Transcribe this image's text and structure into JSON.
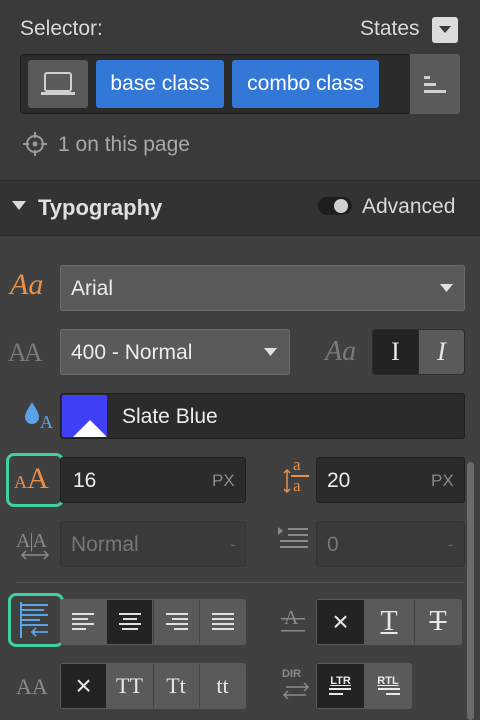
{
  "selector": {
    "label": "Selector:",
    "states_label": "States",
    "chips": [
      "base class",
      "combo class"
    ],
    "count_text": "1 on this page"
  },
  "typography": {
    "title": "Typography",
    "advanced_label": "Advanced",
    "font_family": "Arial",
    "weight": "400 - Normal",
    "color_name": "Slate Blue",
    "color_hex": "#3f3ff5",
    "font_size": "16",
    "font_size_unit": "PX",
    "line_height": "20",
    "line_height_unit": "PX",
    "letter_spacing_placeholder": "Normal",
    "letter_spacing_suffix": "-",
    "text_indent_placeholder": "0",
    "text_indent_suffix": "-",
    "italic_normal": "I",
    "italic_slant": "I",
    "capitalize": {
      "upper": "TT",
      "title": "Tt",
      "lower": "tt"
    },
    "direction": {
      "label": "DIR",
      "ltr": "LTR",
      "rtl": "RTL"
    },
    "decoration": {
      "underline": "T",
      "strike": "T"
    },
    "font_icon_text": "Aa",
    "style_icon_text": "Aa",
    "case_icon_text": "AA",
    "size_icon_small": "A",
    "size_icon_big": "A",
    "line_icon_top": "a",
    "line_icon_bottom": "a",
    "spacing_icon_text": "A|A",
    "clear_symbol": "×"
  },
  "colors": {
    "accent": "#3378d6",
    "highlight": "#3fd1a4",
    "orange": "#e8904a"
  }
}
